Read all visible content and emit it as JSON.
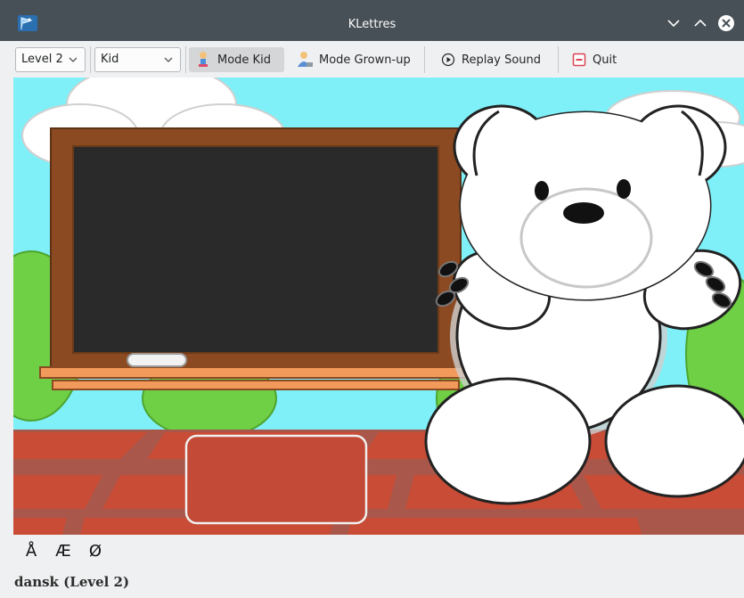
{
  "window": {
    "title": "KLettres"
  },
  "toolbar": {
    "level_select": {
      "value": "Level 2"
    },
    "mode_select": {
      "value": "Kid"
    },
    "mode_kid_label": "Mode Kid",
    "mode_grownup_label": "Mode Grown-up",
    "replay_label": "Replay Sound",
    "quit_label": "Quit"
  },
  "special_letters": [
    "Å",
    "Æ",
    "Ø"
  ],
  "status": {
    "text": "dansk  (Level 2)"
  },
  "icons": {
    "app": "klettres-flag-icon",
    "kid": "kid-icon",
    "grownup": "grownup-icon",
    "replay": "play-circle-icon",
    "quit": "quit-icon"
  },
  "colors": {
    "titlebar": "#475057",
    "sky": "#7ff0f8",
    "bricks": "#c24a36",
    "board": "#2a2a2a",
    "frame": "#8b4a22"
  }
}
